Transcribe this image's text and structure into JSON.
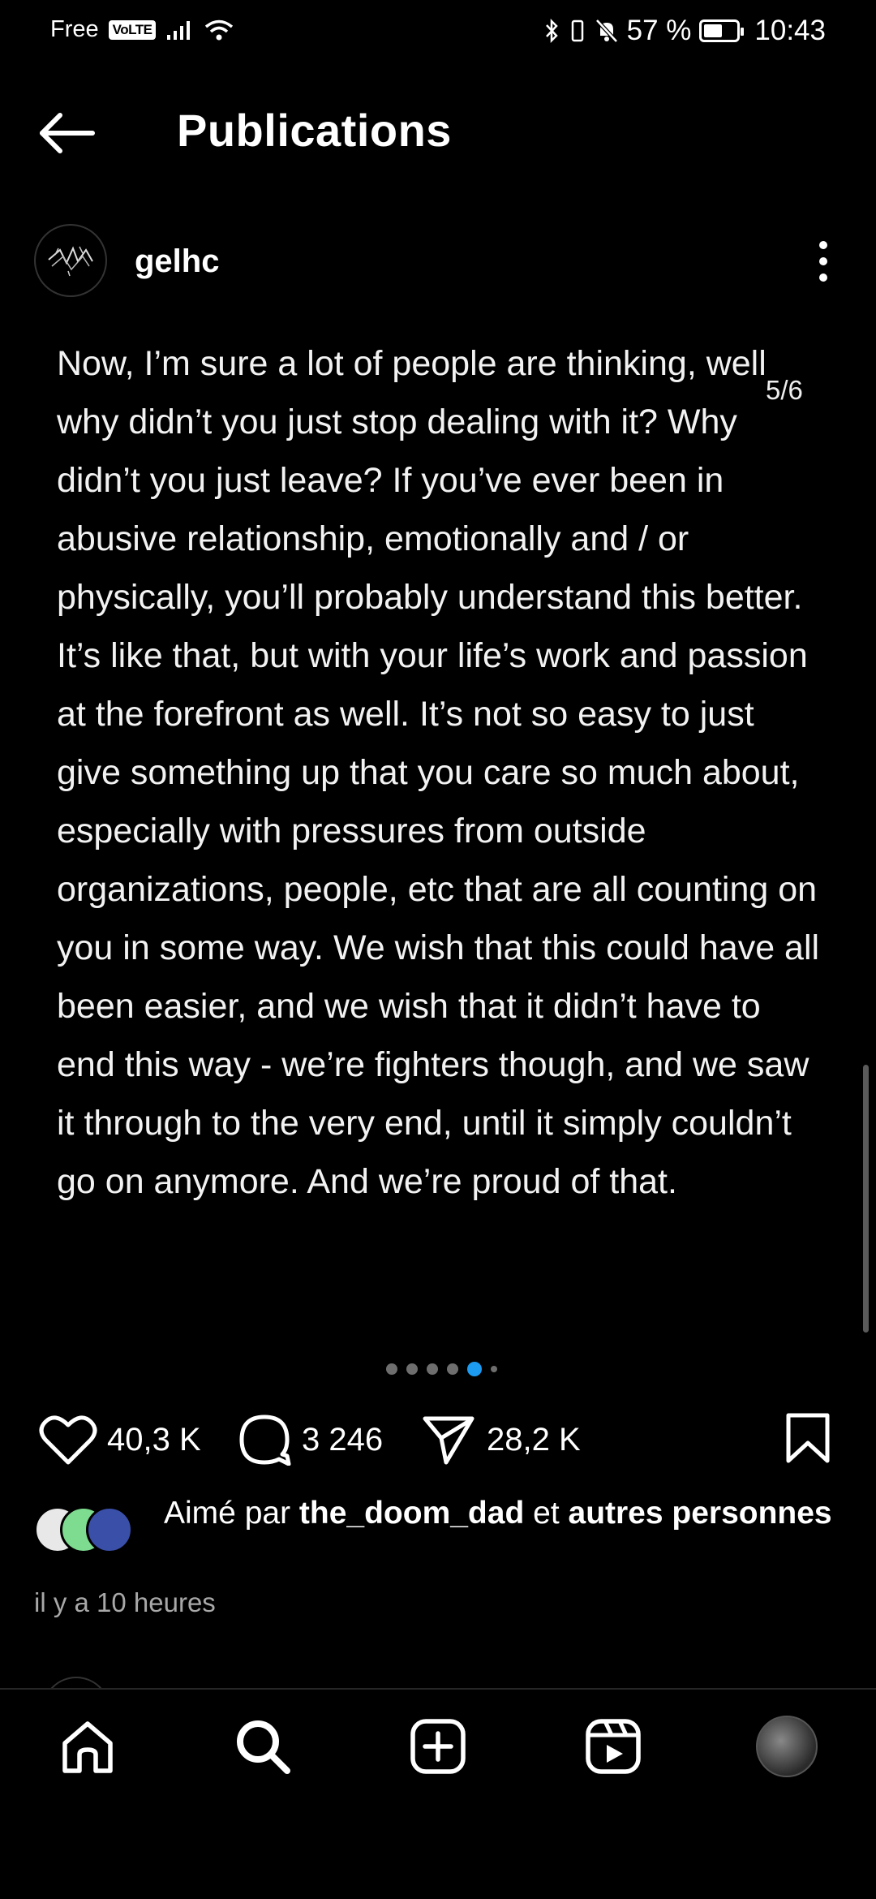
{
  "status_bar": {
    "carrier": "Free",
    "volte": "VoLTE",
    "battery_percent": "57 %",
    "battery_level": 0.57,
    "time": "10:43"
  },
  "header": {
    "title": "Publications",
    "back_icon": "back-arrow-icon"
  },
  "post": {
    "username": "gelhc",
    "slide_counter": "5/6",
    "slide_count": 6,
    "active_slide": 5,
    "text": "Now, I’m sure a lot of people are thinking, well why didn’t you just stop dealing with it? Why didn’t you just leave? If you’ve ever been in abusive relationship, emotionally and / or physically, you’ll probably understand this better. It’s like that, but with your life’s work and passion at the forefront as well. It’s not so easy to just give something up that you care so much about, especially with pressures from outside organizations, people, etc that are all counting on you in some way. We wish that this could have all been easier, and we wish that it didn’t have to end this way - we’re fighters though, and we saw it through to the very end, until it simply couldn’t go on anymore. And we’re proud of that.",
    "likes": "40,3 K",
    "comments": "3 246",
    "shares": "28,2 K",
    "liked_by_prefix": "Aimé par",
    "liked_by_user": "the_doom_dad",
    "liked_by_connector": "et",
    "liked_by_suffix": "autres personnes",
    "time_ago": "il y a 10 heures"
  },
  "nav": {
    "items": [
      "home-icon",
      "search-icon",
      "create-icon",
      "reels-icon",
      "profile-avatar"
    ]
  },
  "colors": {
    "background": "#000000",
    "text": "#ffffff",
    "muted": "#a8a8a8",
    "accent_dot": "#1d9bf0"
  }
}
